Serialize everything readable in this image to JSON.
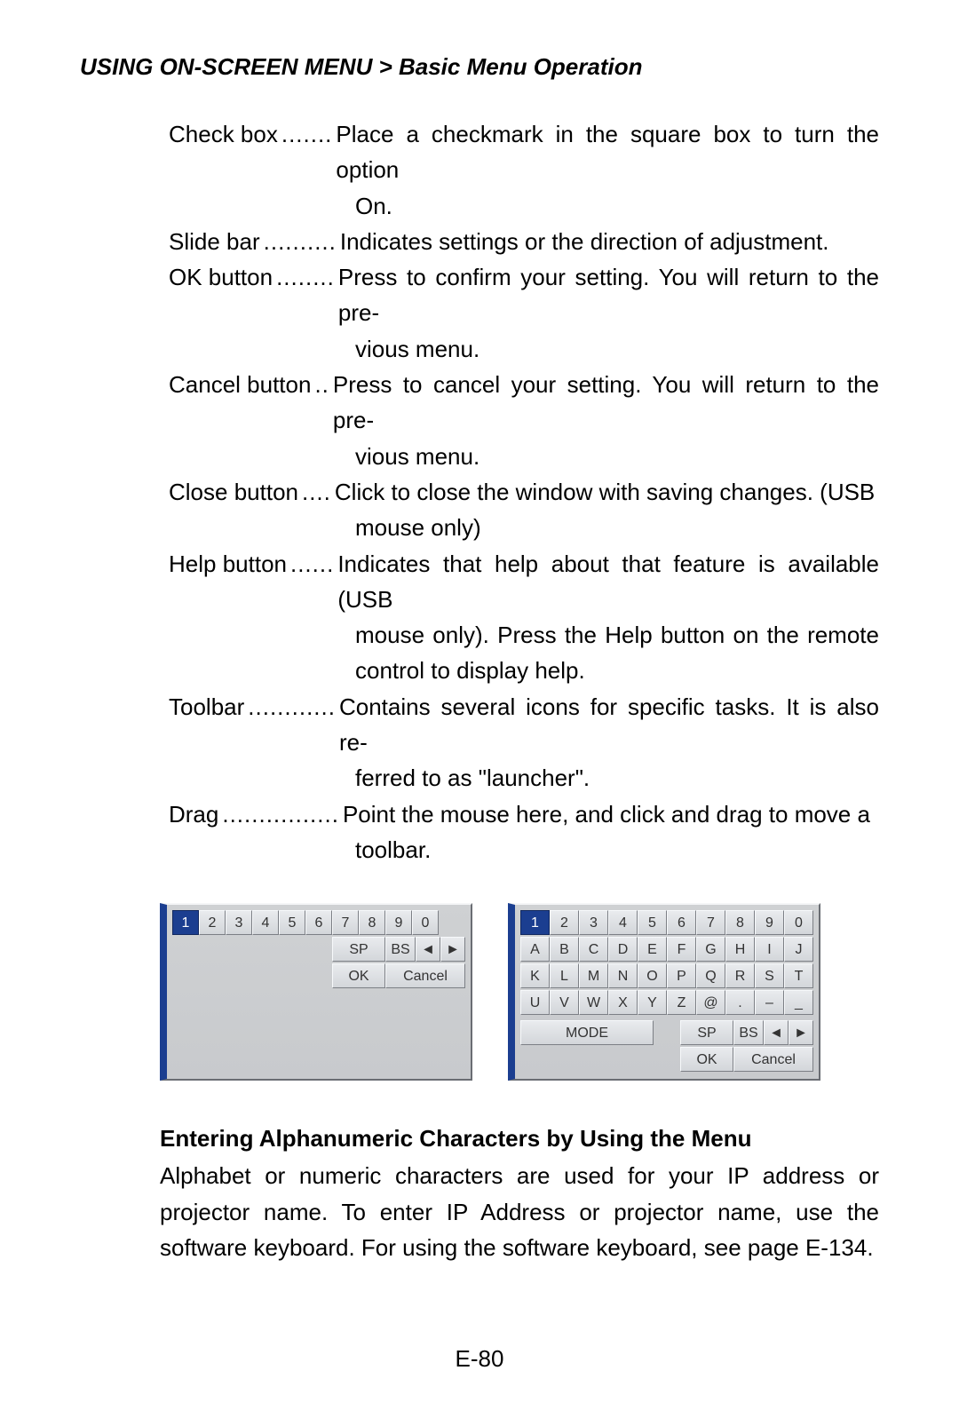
{
  "header": {
    "breadcrumb": "USING ON-SCREEN MENU > Basic Menu Operation"
  },
  "definitions": [
    {
      "term": "Check box",
      "dots": ".......",
      "text_first": "Place a checkmark in the square box to turn the option",
      "text_cont": "On."
    },
    {
      "term": "Slide bar",
      "dots": "..........",
      "text_first": "Indicates settings or the direction of adjustment.",
      "text_cont": ""
    },
    {
      "term": "OK button",
      "dots": "........",
      "text_first": "Press to confirm your setting. You will return to the pre-",
      "text_cont": "vious menu."
    },
    {
      "term": "Cancel button",
      "dots": "..",
      "text_first": "Press to cancel your setting. You will return to the pre-",
      "text_cont": "vious menu."
    },
    {
      "term": "Close button",
      "dots": "....",
      "text_first": "Click to close the window with saving changes. (USB",
      "text_cont": "mouse only)"
    },
    {
      "term": "Help button",
      "dots": "......",
      "text_first": "Indicates that help about that feature is available (USB",
      "text_cont": "mouse only). Press the Help button on the remote control to display help."
    },
    {
      "term": "Toolbar",
      "dots": "............",
      "text_first": "Contains several icons for specific tasks. It is also re-",
      "text_cont": "ferred to as \"launcher\"."
    },
    {
      "term": "Drag",
      "dots": "................",
      "text_first": "Point the mouse here, and click and drag to move a",
      "text_cont": "toolbar."
    }
  ],
  "keypad1": {
    "row1": [
      "1",
      "2",
      "3",
      "4",
      "5",
      "6",
      "7",
      "8",
      "9",
      "0"
    ],
    "row2": {
      "sp": "SP",
      "bs": "BS",
      "left": "◄",
      "right": "►"
    },
    "row3": {
      "ok": "OK",
      "cancel": "Cancel"
    }
  },
  "keypad2": {
    "row1": [
      "1",
      "2",
      "3",
      "4",
      "5",
      "6",
      "7",
      "8",
      "9",
      "0"
    ],
    "row2": [
      "A",
      "B",
      "C",
      "D",
      "E",
      "F",
      "G",
      "H",
      "I",
      "J"
    ],
    "row3": [
      "K",
      "L",
      "M",
      "N",
      "O",
      "P",
      "Q",
      "R",
      "S",
      "T"
    ],
    "row4": [
      "U",
      "V",
      "W",
      "X",
      "Y",
      "Z",
      "@",
      ".",
      "–",
      "_"
    ],
    "row5": {
      "mode": "MODE",
      "sp": "SP",
      "bs": "BS",
      "left": "◄",
      "right": "►"
    },
    "row6": {
      "ok": "OK",
      "cancel": "Cancel"
    }
  },
  "section": {
    "heading": "Entering Alphanumeric Characters by Using the Menu",
    "body": "Alphabet or numeric characters are used for your IP address or projector name. To enter IP Address or projector name, use the software keyboard. For using the software keyboard, see page E-134."
  },
  "page_number": "E-80"
}
